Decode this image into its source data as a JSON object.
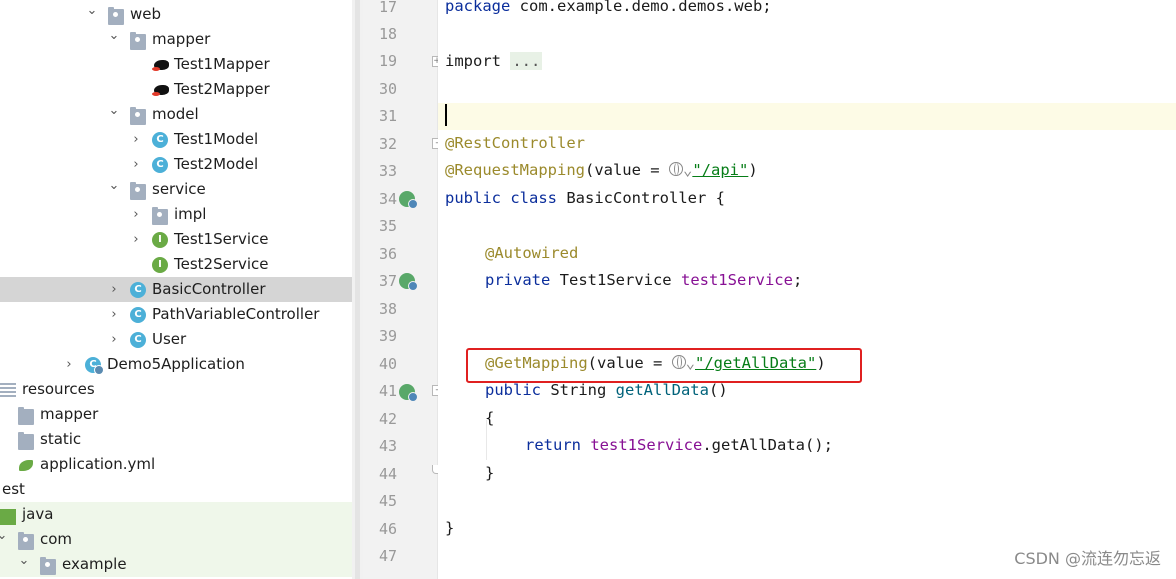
{
  "tree": {
    "rows": [
      {
        "label": "web",
        "indent": 108,
        "arrow": "expanded",
        "icon": "package-folder-icon"
      },
      {
        "label": "mapper",
        "indent": 130,
        "arrow": "expanded",
        "icon": "package-folder-icon"
      },
      {
        "label": "Test1Mapper",
        "indent": 152,
        "arrow": "none",
        "icon": "mybatis-icon"
      },
      {
        "label": "Test2Mapper",
        "indent": 152,
        "arrow": "none",
        "icon": "mybatis-icon"
      },
      {
        "label": "model",
        "indent": 130,
        "arrow": "expanded",
        "icon": "package-folder-icon"
      },
      {
        "label": "Test1Model",
        "indent": 152,
        "arrow": "collapsed",
        "icon": "class-icon"
      },
      {
        "label": "Test2Model",
        "indent": 152,
        "arrow": "collapsed",
        "icon": "class-icon"
      },
      {
        "label": "service",
        "indent": 130,
        "arrow": "expanded",
        "icon": "package-folder-icon"
      },
      {
        "label": "impl",
        "indent": 152,
        "arrow": "collapsed",
        "icon": "package-folder-icon"
      },
      {
        "label": "Test1Service",
        "indent": 152,
        "arrow": "collapsed",
        "icon": "interface-icon"
      },
      {
        "label": "Test2Service",
        "indent": 152,
        "arrow": "none",
        "icon": "interface-icon"
      },
      {
        "label": "BasicController",
        "indent": 130,
        "arrow": "collapsed",
        "icon": "class-icon",
        "selected": true
      },
      {
        "label": "PathVariableController",
        "indent": 130,
        "arrow": "collapsed",
        "icon": "class-icon"
      },
      {
        "label": "User",
        "indent": 130,
        "arrow": "collapsed",
        "icon": "class-icon"
      },
      {
        "label": "Demo5Application",
        "indent": 85,
        "arrow": "collapsed",
        "icon": "spring-app-icon"
      },
      {
        "label": "resources",
        "indent": 0,
        "arrow": "none",
        "icon": "resources-folder-icon"
      },
      {
        "label": "mapper",
        "indent": 18,
        "arrow": "none",
        "icon": "folder-icon"
      },
      {
        "label": "static",
        "indent": 18,
        "arrow": "none",
        "icon": "folder-icon"
      },
      {
        "label": "application.yml",
        "indent": 18,
        "arrow": "none",
        "icon": "spring-yml-icon"
      },
      {
        "label": "est",
        "indent": 0,
        "arrow": "none",
        "icon": "none"
      },
      {
        "label": "java",
        "indent": 0,
        "arrow": "none",
        "icon": "source-folder-icon",
        "green": true
      },
      {
        "label": "com",
        "indent": 18,
        "arrow": "expanded",
        "icon": "package-folder-icon",
        "green": true
      },
      {
        "label": "example",
        "indent": 40,
        "arrow": "expanded",
        "icon": "package-folder-icon",
        "green": true
      }
    ]
  },
  "editor": {
    "line_numbers": [
      "17",
      "18",
      "19",
      "30",
      "31",
      "32",
      "33",
      "34",
      "35",
      "36",
      "37",
      "38",
      "39",
      "40",
      "41",
      "42",
      "43",
      "44",
      "45",
      "46",
      "47"
    ],
    "lines": {
      "l17": {
        "kw": "package",
        "rest": " com.example.demo.demos.web;"
      },
      "l19": {
        "kw": "import",
        "fold": "..."
      },
      "l32": {
        "ann": "@RestController"
      },
      "l33": {
        "ann": "@RequestMapping",
        "open": "(value = ",
        "str": "\"/api\"",
        "close": ")"
      },
      "l34": {
        "kw1": "public",
        "kw2": "class",
        "rest": " BasicController {"
      },
      "l36": {
        "ann": "@Autowired"
      },
      "l37": {
        "kw": "private",
        "type": " Test1Service ",
        "field": "test1Service",
        "end": ";"
      },
      "l40": {
        "ann": "@GetMapping",
        "open": "(value = ",
        "str": "\"/getAllData\"",
        "close": ")"
      },
      "l41": {
        "kw": "public",
        "type": " String ",
        "method": "getAllData",
        "end": "()"
      },
      "l42": {
        "text": "{"
      },
      "l43": {
        "kw": "return",
        "field": "test1Service",
        "rest": ".getAllData();"
      },
      "l44": {
        "text": "}"
      },
      "l46": {
        "text": "}"
      }
    }
  },
  "watermark": "CSDN @流连勿忘返"
}
